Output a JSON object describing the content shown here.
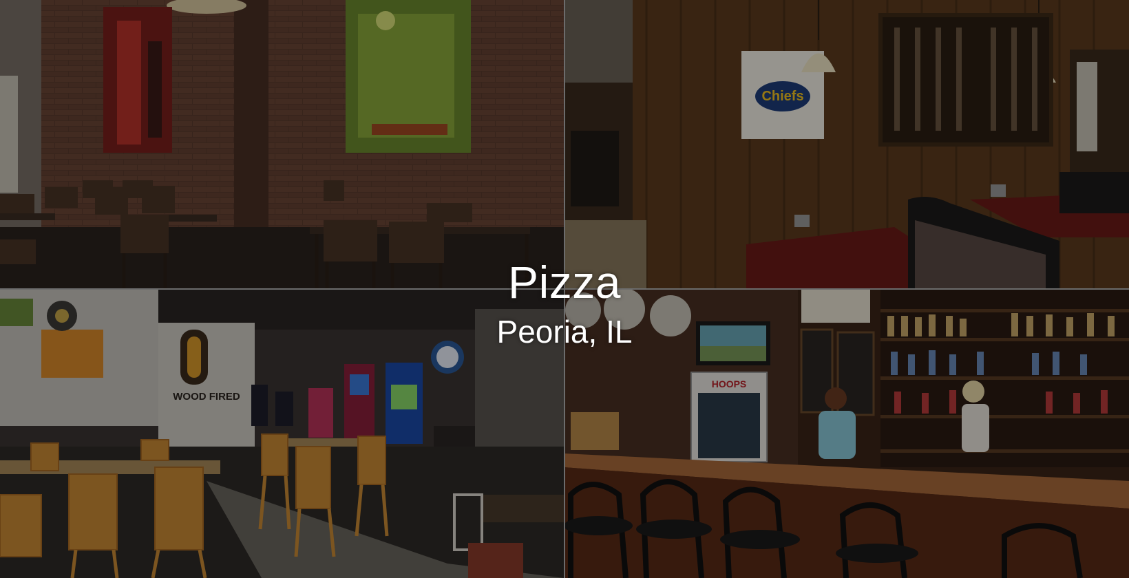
{
  "overlay": {
    "title": "Pizza",
    "subtitle": "Peoria, IL"
  },
  "photos": [
    {
      "name": "photo-dining-room-brick-wall",
      "depicts": "dining-room-brick-wall"
    },
    {
      "name": "photo-wood-paneled-booths",
      "depicts": "wood-paneled-booths"
    },
    {
      "name": "photo-gaming-area-orange-chairs",
      "depicts": "gaming-area-orange-chairs"
    },
    {
      "name": "photo-bar-counter-bottles",
      "depicts": "bar-counter-bottles"
    }
  ],
  "signage": {
    "wood_fired_sign": "WOOD FIRED",
    "hoops_sign": "HOOPS",
    "chiefs_logo": "Chiefs"
  },
  "colors": {
    "brick": "#5a3b2e",
    "wood_panel": "#5c3b1e",
    "orange_chair": "#c98a35",
    "bar_wood": "#6e3a1c",
    "divider": "#6c6c6c",
    "text": "#ffffff"
  }
}
